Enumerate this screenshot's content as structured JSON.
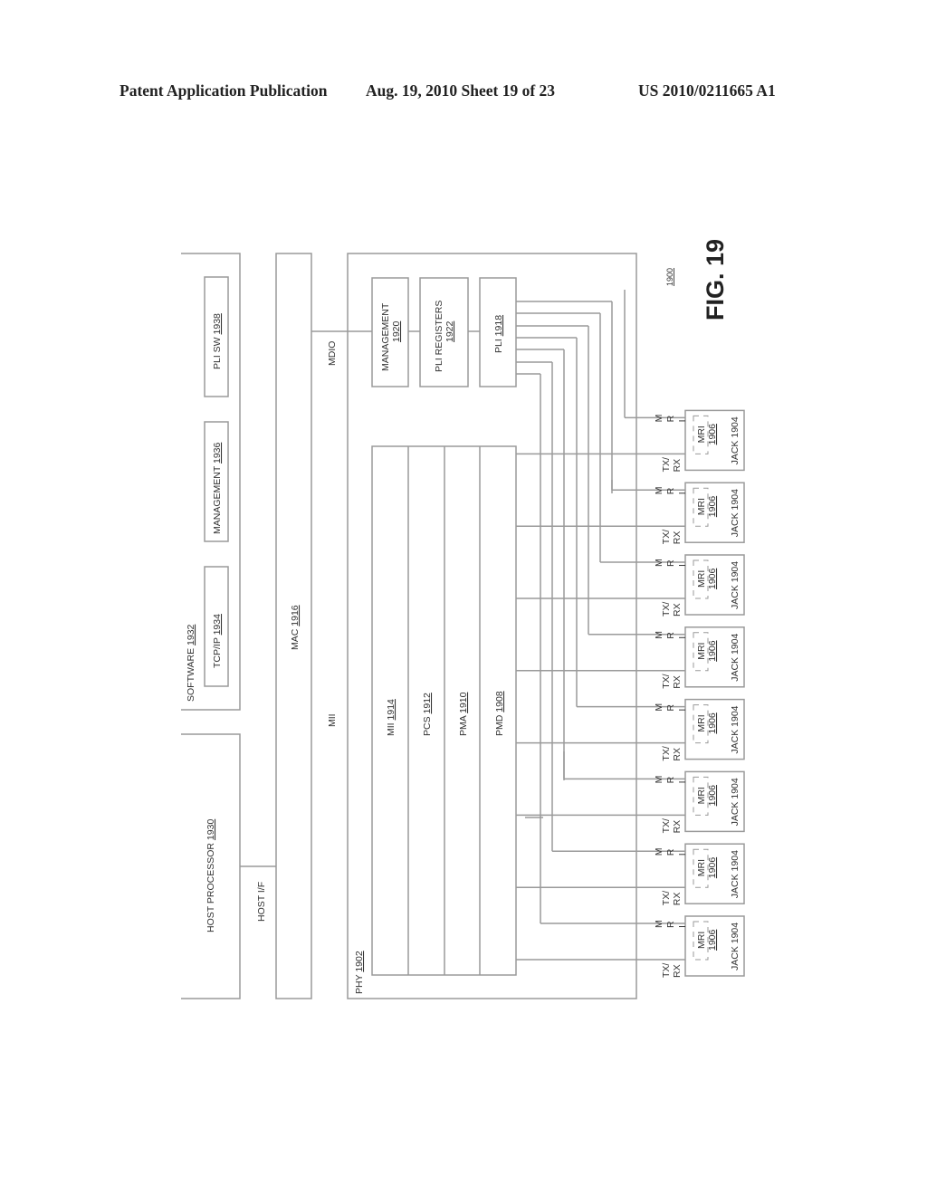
{
  "header": {
    "left": "Patent Application Publication",
    "date_sheet": "Aug. 19, 2010  Sheet 19 of 23",
    "number": "US 2010/0211665 A1"
  },
  "figure": {
    "label": "FIG. 19",
    "ref": "1900",
    "host_processor": {
      "name": "HOST PROCESSOR",
      "ref": "1930"
    },
    "host_if": "HOST I/F",
    "software": {
      "name": "SOFTWARE",
      "ref": "1932"
    },
    "tcpip": {
      "name": "TCP/IP",
      "ref": "1934"
    },
    "management_sw": {
      "name": "MANAGEMENT",
      "ref": "1936"
    },
    "pli_sw": {
      "name": "PLI SW",
      "ref": "1938"
    },
    "mac": {
      "name": "MAC",
      "ref": "1916"
    },
    "mii_link": "MII",
    "mdio_link": "MDIO",
    "phy": {
      "name": "PHY",
      "ref": "1902"
    },
    "management_hw": {
      "name": "MANAGEMENT",
      "ref": "1920"
    },
    "pli_registers": {
      "name": "PLI REGISTERS",
      "ref": "1922"
    },
    "pli": {
      "name": "PLI",
      "ref": "1918"
    },
    "layers": [
      {
        "name": "MII",
        "ref": "1914"
      },
      {
        "name": "PCS",
        "ref": "1912"
      },
      {
        "name": "PMA",
        "ref": "1910"
      },
      {
        "name": "PMD",
        "ref": "1908"
      }
    ],
    "jack": {
      "name": "JACK",
      "ref": "1904"
    },
    "mri": {
      "name": "MRI",
      "ref": "1906"
    },
    "txrx_label": [
      "TX/",
      "RX"
    ],
    "mri_label": [
      "M",
      "R",
      "I"
    ],
    "jack_count": 8
  }
}
